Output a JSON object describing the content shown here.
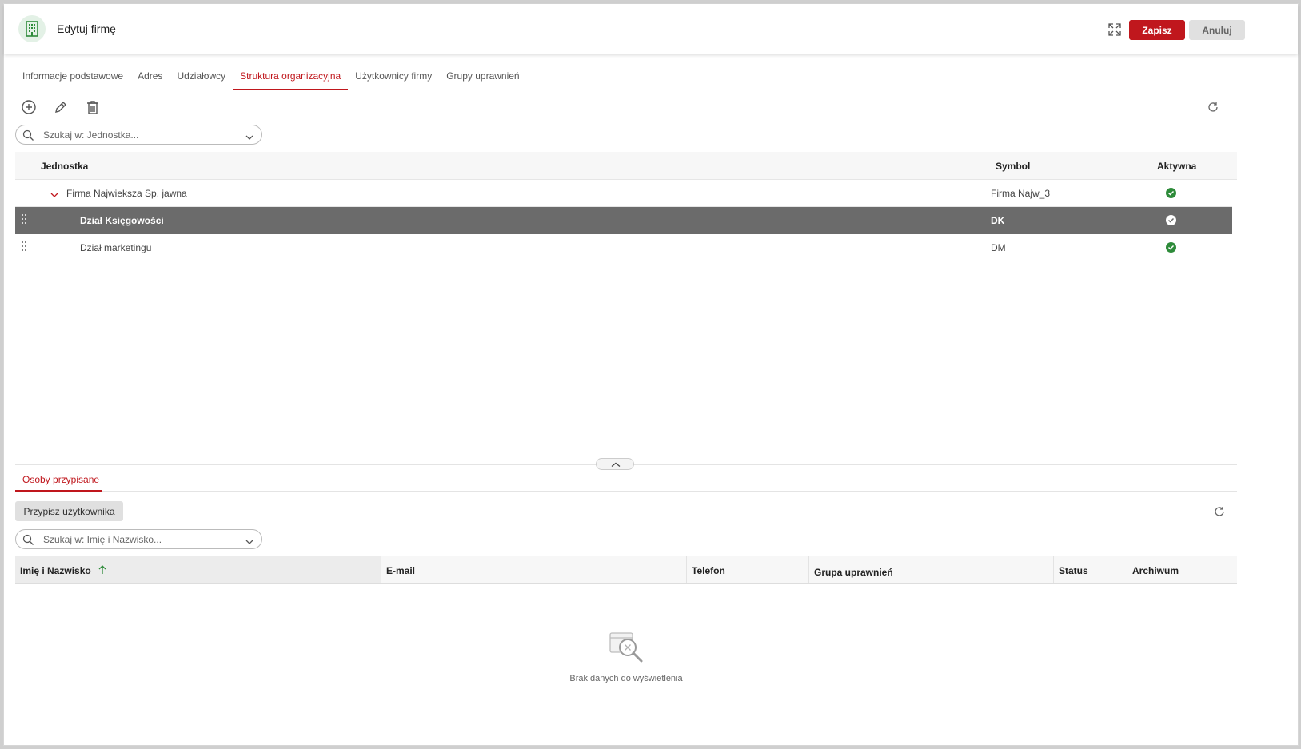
{
  "header": {
    "title": "Edytuj firmę",
    "save_label": "Zapisz",
    "cancel_label": "Anuluj"
  },
  "tabs": [
    {
      "label": "Informacje podstawowe",
      "active": false
    },
    {
      "label": "Adres",
      "active": false
    },
    {
      "label": "Udziałowcy",
      "active": false
    },
    {
      "label": "Struktura organizacyjna",
      "active": true
    },
    {
      "label": "Użytkownicy firmy",
      "active": false
    },
    {
      "label": "Grupy uprawnień",
      "active": false
    }
  ],
  "units": {
    "search_placeholder": "Szukaj w: Jednostka...",
    "columns": {
      "name": "Jednostka",
      "symbol": "Symbol",
      "active": "Aktywna"
    },
    "rows": [
      {
        "name": "Firma Najwieksza Sp. jawna",
        "symbol": "Firma Najw_3",
        "active": true,
        "expanded": true
      },
      {
        "name": "Dział Księgowości",
        "symbol": "DK",
        "active": true,
        "selected": true
      },
      {
        "name": "Dział marketingu",
        "symbol": "DM",
        "active": true
      }
    ]
  },
  "people": {
    "tab_label": "Osoby przypisane",
    "assign_label": "Przypisz użytkownika",
    "search_placeholder": "Szukaj w: Imię i Nazwisko...",
    "columns": {
      "name": "Imię i Nazwisko",
      "email": "E-mail",
      "phone": "Telefon",
      "group": "Grupa uprawnień",
      "status": "Status",
      "archive": "Archiwum"
    },
    "empty_text": "Brak danych do wyświetlenia"
  },
  "colors": {
    "accent": "#c0171d",
    "active_check": "#2e8b3a",
    "selected_row": "#6b6b6b"
  }
}
